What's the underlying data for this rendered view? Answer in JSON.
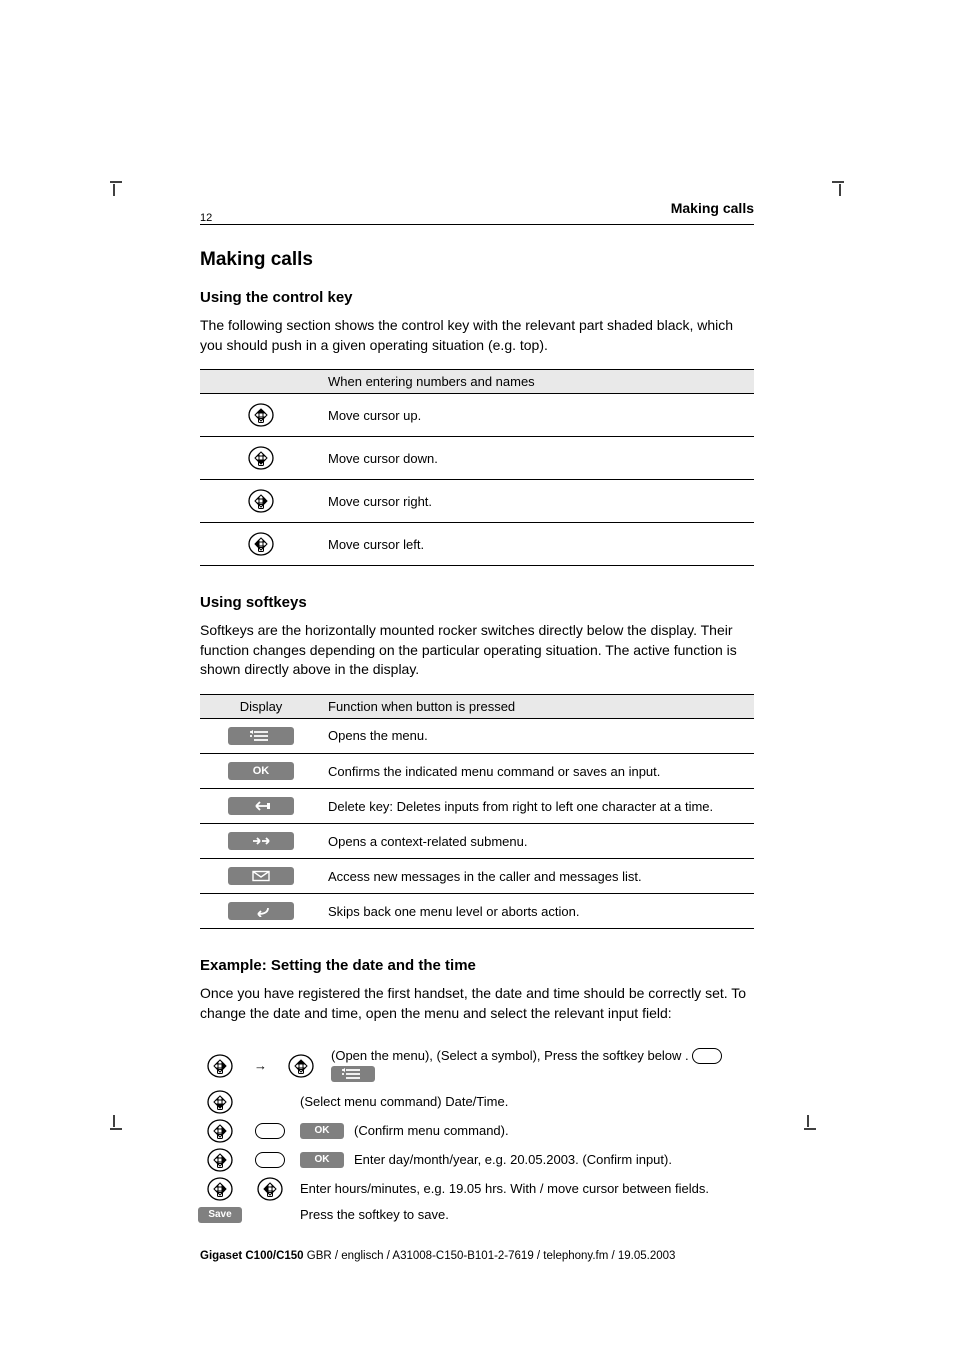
{
  "header": {
    "title": "Making calls",
    "page": "12"
  },
  "h1": "Making calls",
  "nav_head": "Using the control key",
  "nav_intro": "The following section shows the control key with the relevant part shaded black, which you should push in a given operating situation (e.g. top).",
  "nav_table": {
    "head_left": "",
    "head_right": "When entering numbers and names",
    "rows": [
      {
        "dir": "u",
        "text": "Move cursor up."
      },
      {
        "dir": "d",
        "text": "Move cursor down."
      },
      {
        "dir": "r",
        "text": "Move cursor right."
      },
      {
        "dir": "l",
        "text": "Move cursor left."
      }
    ]
  },
  "soft_head": "Using softkeys",
  "soft_intro": "Softkeys are the horizontally mounted rocker switches directly below the display. Their function changes depending on the particular operating situation. The active function is shown directly above in the display.",
  "soft_table": {
    "head_left": "Display",
    "head_right": "Function when button is pressed",
    "rows": [
      {
        "icon": "menu",
        "text": "Opens the menu."
      },
      {
        "icon": "OK",
        "text": "Confirms the indicated menu command or saves an input."
      },
      {
        "icon": "back",
        "text": "Delete key: Deletes inputs from right to left one character at a time."
      },
      {
        "icon": "fwd",
        "text": "Opens a context-related submenu."
      },
      {
        "icon": "mail",
        "text": "Access new messages in the caller and messages list."
      },
      {
        "icon": "return",
        "text": "Skips back one menu level or aborts action."
      }
    ]
  },
  "ex_head": "Example: Setting the date and the time",
  "ex_intro": "Once you have registered the first handset, the date and time should be correctly set. To change the date and time, open the menu and select the relevant input field:",
  "steps": [
    {
      "lead": "r",
      "extra": "u_arrow",
      "rhs_pill": true,
      "rhs_key": "menu",
      "text": "(Open the menu),  (Select a symbol),  Press the softkey below  ."
    },
    {
      "lead": "d",
      "text": "(Select menu command) Date/Time."
    },
    {
      "lead": "r",
      "key": "OK",
      "text": "(Confirm menu command)."
    },
    {
      "lead": "r",
      "key": "OK",
      "text": "Enter day/month/year, e.g. 20.05.2003. (Confirm input)."
    },
    {
      "lead": "r",
      "extra": "l",
      "text": "Enter hours/minutes, e.g. 19.05 hrs. With  /  move cursor between fields."
    },
    {
      "save": "Save",
      "text": "Press the softkey to save."
    }
  ],
  "caption": {
    "model": "Gigaset C100/C150",
    "lang": "GBR / englisch",
    "doc": "/ A31008-C150-B101-2-7619 / telephony.fm / 19.05.2003"
  },
  "labels": {
    "save": "Save",
    "ok": "OK"
  }
}
